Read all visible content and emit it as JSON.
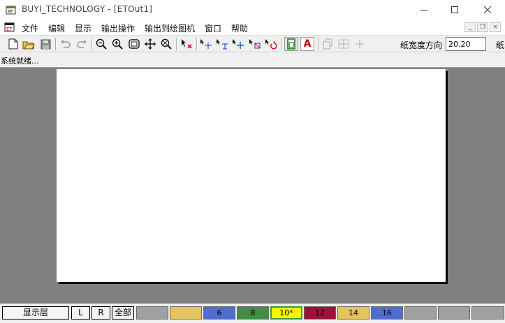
{
  "window": {
    "title": "BUYI_TECHNOLOGY - [ETOut1]",
    "minimize_glyph": "—",
    "maximize_glyph": "☐",
    "close_glyph": "✕"
  },
  "menu": {
    "items": [
      "文件",
      "编辑",
      "显示",
      "输出操作",
      "输出到绘图机",
      "窗口",
      "帮助"
    ],
    "mdi_min": "_",
    "mdi_restore": "❐",
    "mdi_close": "×"
  },
  "toolbar": {
    "paper_width_label": "纸宽度方向",
    "paper_width_value": "20.20",
    "overflow_label": "纸",
    "text_tool_glyph": "A",
    "icons": [
      "new-file-icon",
      "open-folder-icon",
      "save-icon",
      "undo-icon",
      "redo-icon",
      "zoom-out-icon",
      "zoom-in-icon",
      "fit-view-icon",
      "pan-icon",
      "zoom-window-icon",
      "delete-select-icon",
      "move-icon",
      "align-icon",
      "crosshair-move-icon",
      "delete-node-icon",
      "rotate-icon",
      "page-icon",
      "text-tool-icon",
      "copy-disabled-icon",
      "group-disabled-icon",
      "plus-disabled-icon"
    ]
  },
  "status": {
    "text": "系统就绪..."
  },
  "bottombar": {
    "layer_button": "显示层",
    "left_button": "L",
    "right_button": "R",
    "all_button": "全部",
    "colors": [
      {
        "label": "",
        "color": "#a0a0a0"
      },
      {
        "label": "",
        "color": "#e6c35c"
      },
      {
        "label": "6",
        "color": "#4f6fd0"
      },
      {
        "label": "8",
        "color": "#3e8f3e"
      },
      {
        "label": "10*",
        "color": "#f5f500"
      },
      {
        "label": "12",
        "color": "#a0103a"
      },
      {
        "label": "14",
        "color": "#e6c35c"
      },
      {
        "label": "16",
        "color": "#4f6fd0"
      },
      {
        "label": "",
        "color": "#a0a0a0"
      },
      {
        "label": "",
        "color": "#a0a0a0"
      },
      {
        "label": "",
        "color": "#a0a0a0"
      }
    ]
  }
}
